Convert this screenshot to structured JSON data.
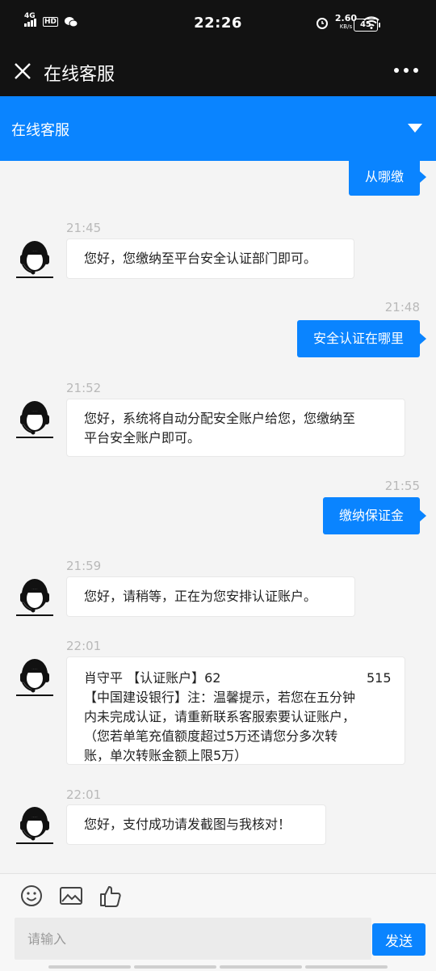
{
  "status_bar": {
    "time": "22:26",
    "network": "4G",
    "hd": "HD",
    "speed_value": "2.60",
    "speed_unit": "KB/s",
    "battery": "45"
  },
  "header": {
    "title": "在线客服"
  },
  "banner": {
    "label": "在线客服"
  },
  "messages": [
    {
      "type": "out",
      "text": "从哪缴"
    },
    {
      "type": "in",
      "time": "21:45",
      "text": "您好，您缴纳至平台安全认证部门即可。"
    },
    {
      "type": "out",
      "time": "21:48",
      "text": "安全认证在哪里"
    },
    {
      "type": "in",
      "time": "21:52",
      "lines": [
        "您好，系统将自动分配安全账户给您，您缴纳至",
        "平台安全账户即可。"
      ]
    },
    {
      "type": "out",
      "time": "21:55",
      "text": "缴纳保证金"
    },
    {
      "type": "in",
      "time": "21:59",
      "text": "您好，请稍等，正在为您安排认证账户。"
    },
    {
      "type": "in",
      "time": "22:01",
      "lines": [
        "肖守平 【认证账户】62",
        "515",
        "【中国建设银行】注：温馨提示，若您在五分钟",
        "内未完成认证，请重新联系客服索要认证账户，",
        "（您若单笔充值额度超过5万还请您分多次转",
        "账，单次转账金额上限5万）"
      ]
    },
    {
      "type": "in",
      "time": "22:01",
      "text": "您好，支付成功请发截图与我核对！"
    }
  ],
  "composer": {
    "placeholder": "请输入",
    "send_label": "发送"
  },
  "colors": {
    "accent": "#0a84ff",
    "dark_bar": "#121212",
    "background": "#f4f4f4"
  },
  "icons": [
    "close-icon",
    "more-icon",
    "chevron-down-icon",
    "emoji-icon",
    "image-icon",
    "thumbs-up-icon",
    "agent-avatar-icon"
  ]
}
